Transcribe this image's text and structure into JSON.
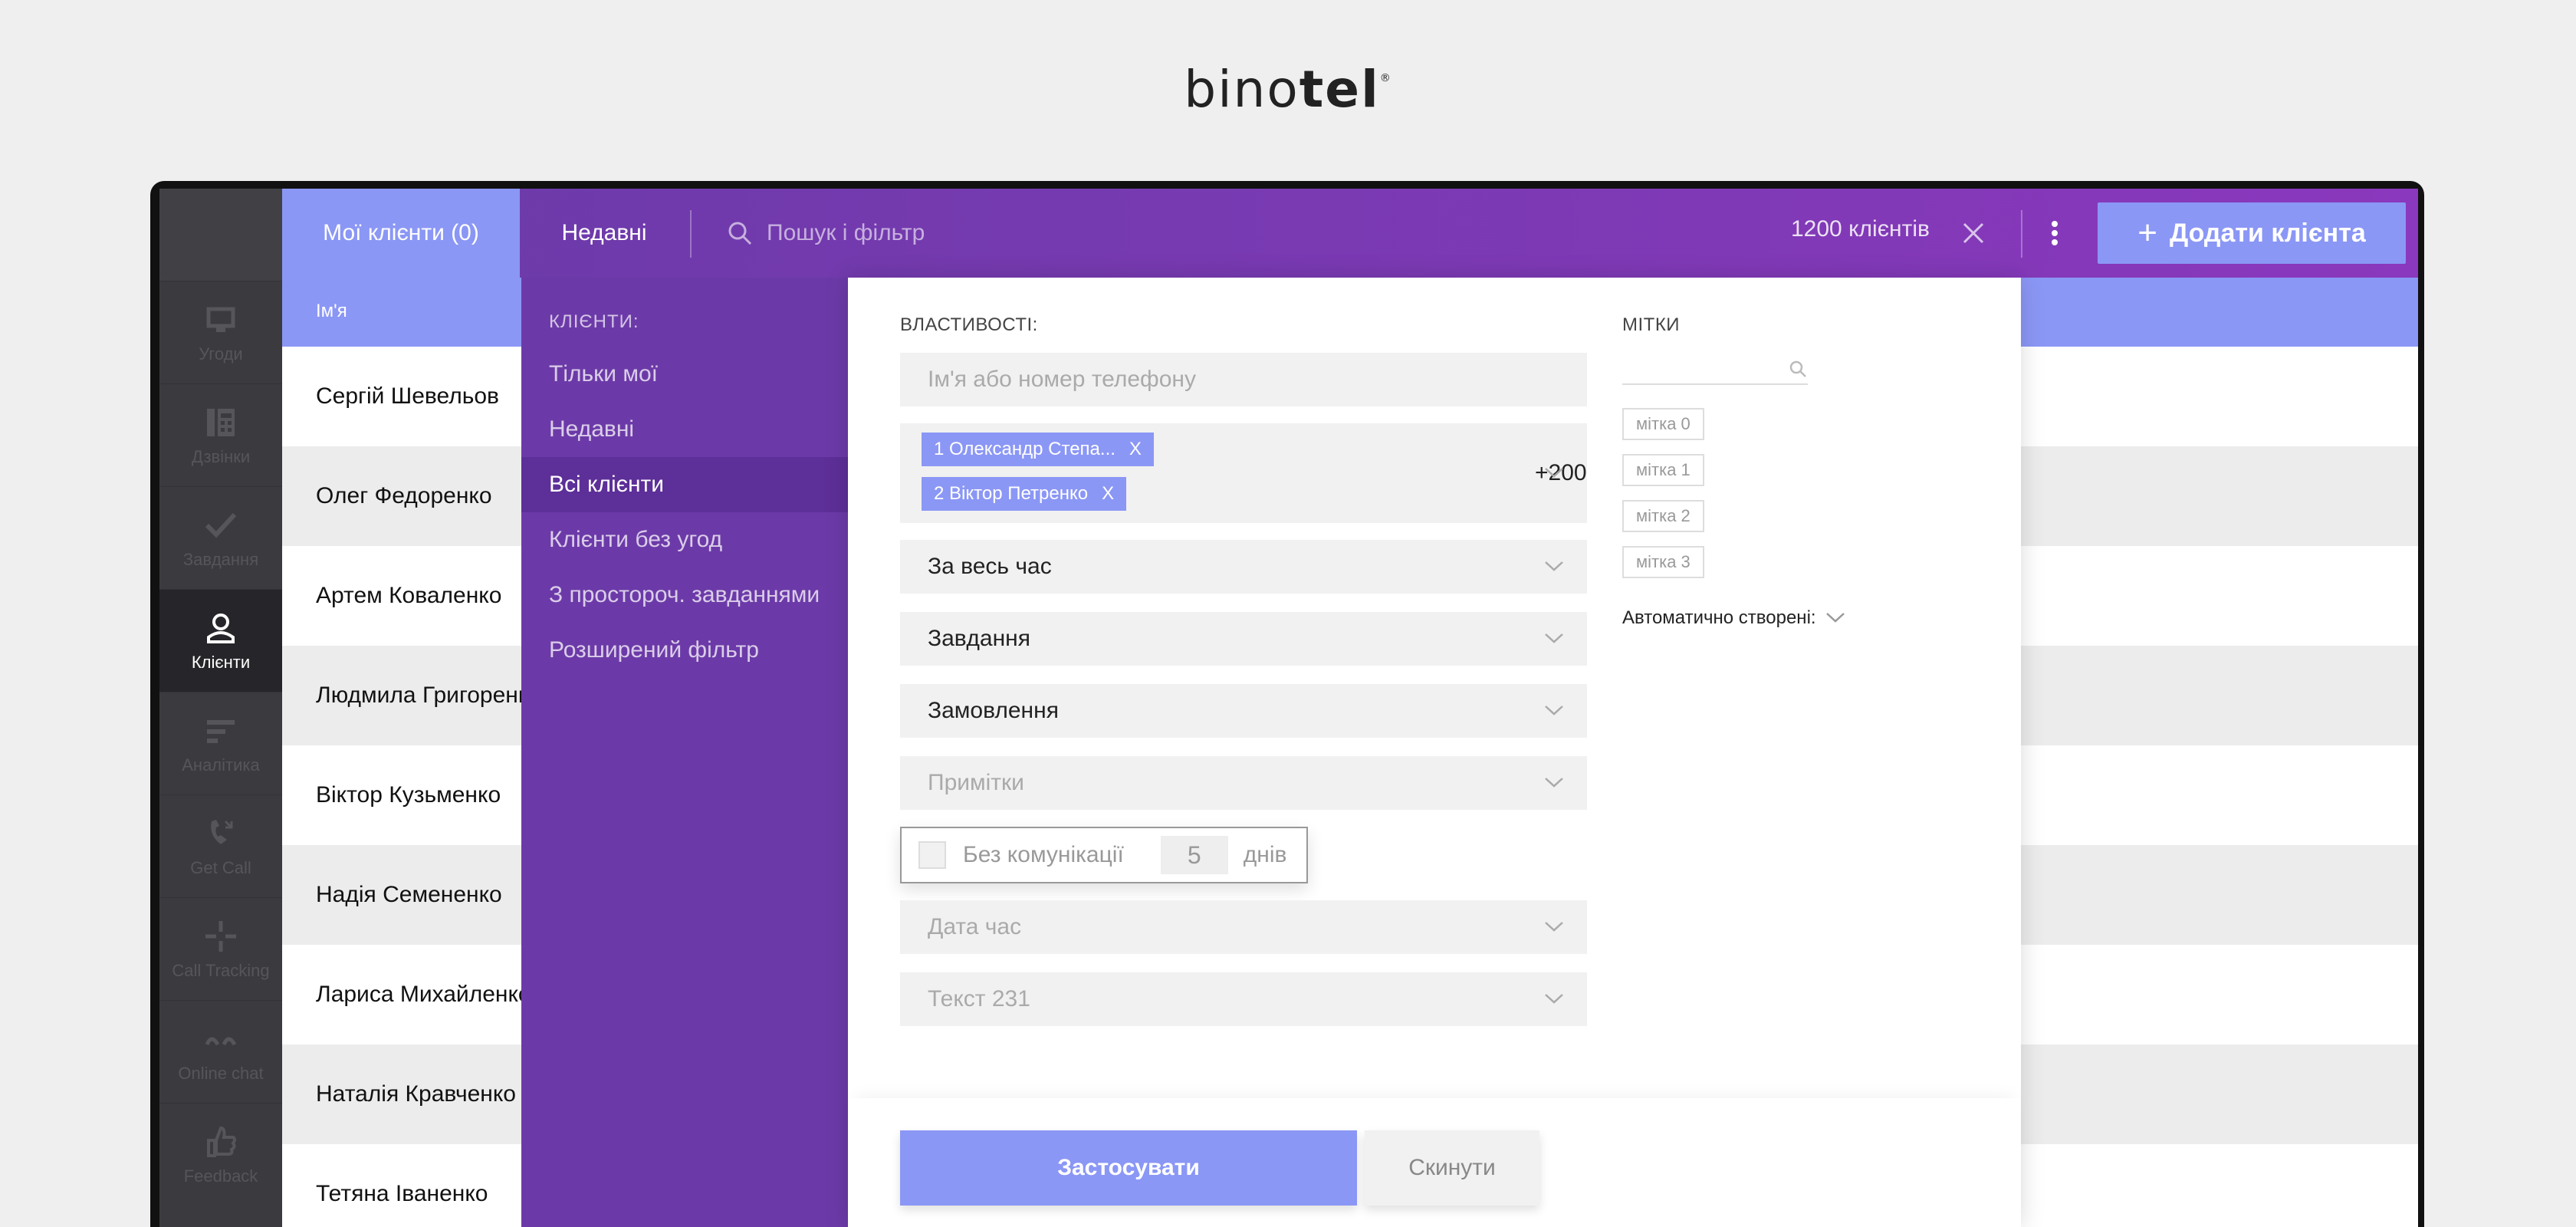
{
  "brand": {
    "name_light": "bino",
    "name_bold": "tel",
    "mark": "®"
  },
  "sidebar": {
    "items": [
      {
        "label": "Угоди",
        "icon": "deals-icon"
      },
      {
        "label": "Дзвінки",
        "icon": "phone-icon"
      },
      {
        "label": "Завдання",
        "icon": "check-icon"
      },
      {
        "label": "Клієнти",
        "icon": "client-icon",
        "active": true
      },
      {
        "label": "Аналітика",
        "icon": "analytics-icon"
      },
      {
        "label": "Get Call",
        "icon": "get-call-icon"
      },
      {
        "label": "Call Tracking",
        "icon": "call-tracking-icon"
      },
      {
        "label": "Online chat",
        "icon": "chat-icon"
      },
      {
        "label": "Feedback",
        "icon": "feedback-icon"
      }
    ]
  },
  "topbar": {
    "tab_my": "Мої клієнти (0)",
    "tab_recent": "Недавні",
    "search_placeholder": "Пошук і фільтр",
    "count": "1200 клієнтів",
    "add_button": "Додати клієнта",
    "add_plus": "+"
  },
  "list": {
    "header_name": "Ім'я",
    "rows": [
      "Сергій Шевельов",
      "Олег Федоренко",
      "Артем Коваленко",
      "Людмила Григоренко",
      "Віктор Кузьменко",
      "Надія Семененко",
      "Лариса Михайленко",
      "Наталія Кравченко",
      "Тетяна Іваненко"
    ]
  },
  "filter_side": {
    "title": "КЛІЄНТИ:",
    "items": [
      "Тільки мої",
      "Недавні",
      "Всі клієнти",
      "Клієнти без угод",
      "З простороч. завданнями",
      "Розширений фільтр"
    ],
    "active_index": 2
  },
  "panel": {
    "properties_label": "ВЛАСТИВОСТІ:",
    "name_phone_placeholder": "Ім'я або номер телефону",
    "chips": [
      "1 Олександр Степа...",
      "2 Віктор Петренко"
    ],
    "chip_close": "X",
    "more_count": "+200",
    "period": "За весь час",
    "tasks": "Завдання",
    "orders": "Замовлення",
    "notes": "Примітки",
    "no_comm_label": "Без комунікації",
    "no_comm_days": "5",
    "no_comm_unit": "днів",
    "date_time": "Дата час",
    "text_field": "Текст 231",
    "tags_label": "МІТКИ",
    "tags": [
      "мітка 0",
      "мітка 1",
      "мітка 2",
      "мітка 3"
    ],
    "auto_created": "Автоматично створені:",
    "apply": "Застосувати",
    "reset": "Скинути"
  },
  "colors": {
    "accent": "#8b97f5",
    "purple": "#6c3aa8",
    "nav": "#3b3b3f"
  }
}
